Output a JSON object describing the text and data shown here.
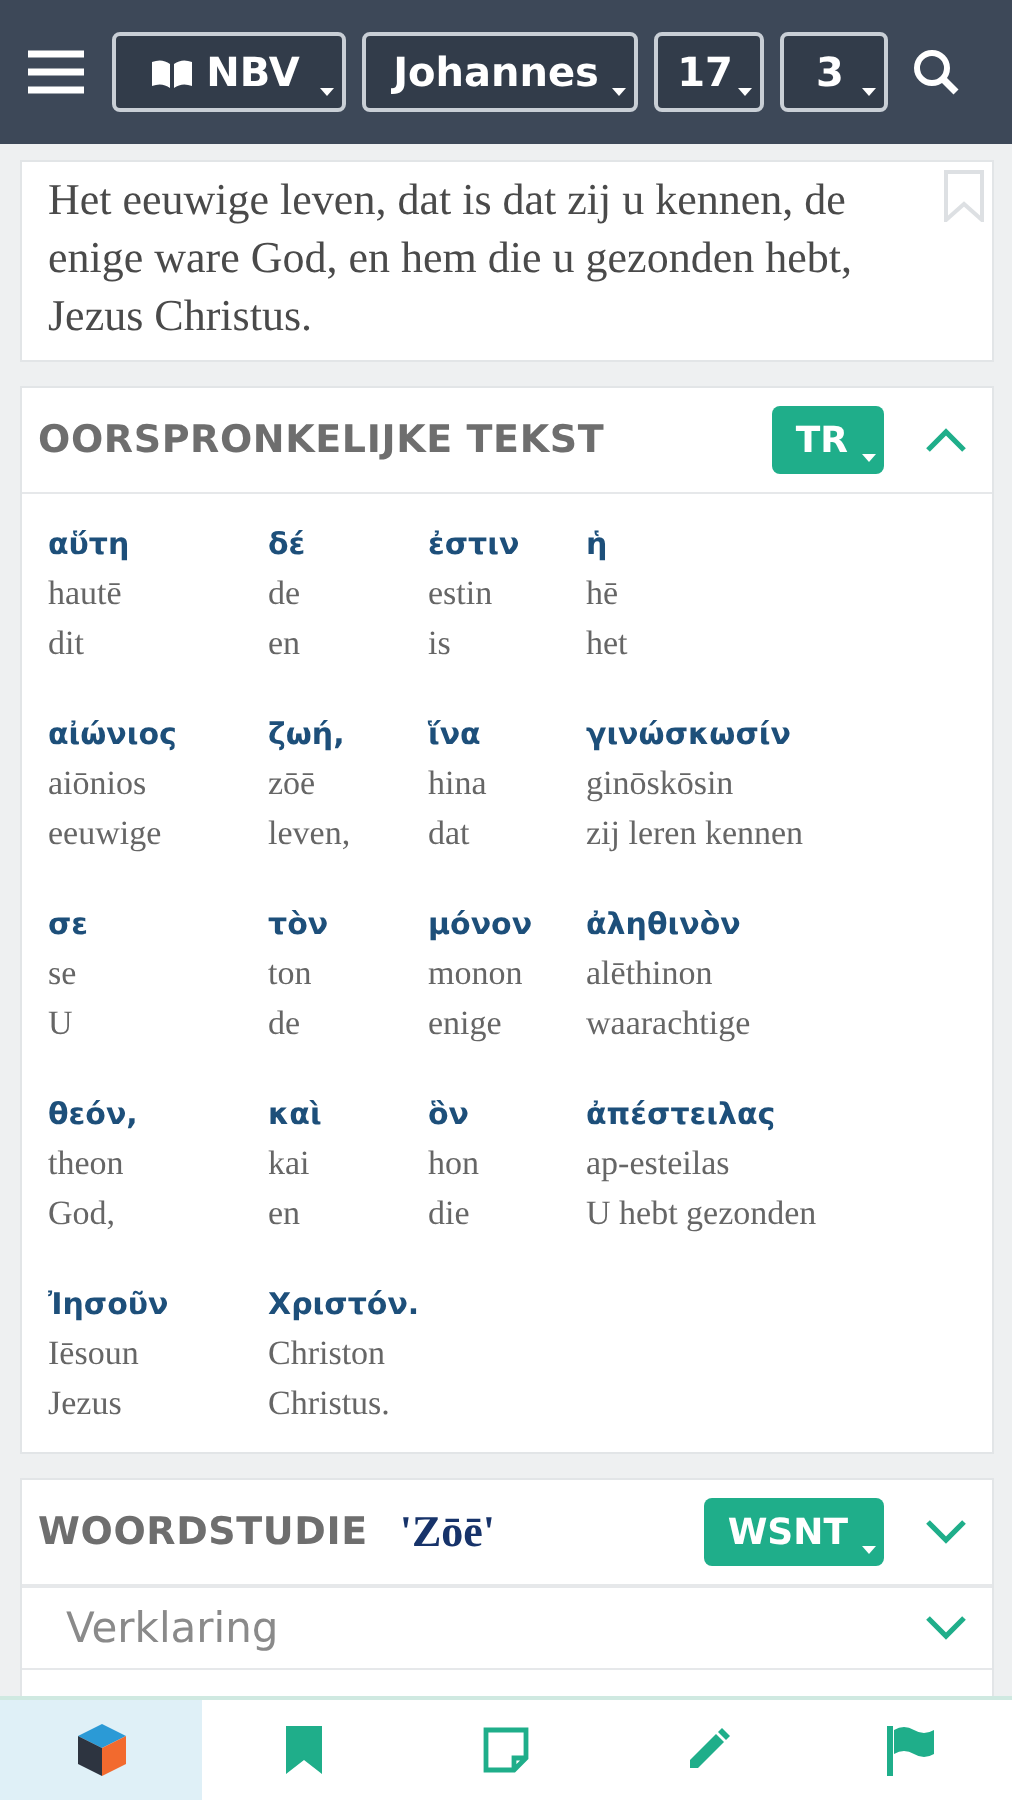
{
  "toolbar": {
    "translation": "NBV",
    "book": "Johannes",
    "chapter": "17",
    "verse": "3"
  },
  "verse": {
    "text": "Het eeuwige leven, dat is dat zij u kennen, de enige ware God, en hem die u gezonden hebt, Jezus Christus.",
    "bookmarked": false
  },
  "original_text": {
    "title": "OORSPRONKELIJKE TEKST",
    "source": "TR",
    "expanded": true,
    "words": [
      {
        "greek": "αὕτη",
        "transliteration": "hautē",
        "translation": "dit"
      },
      {
        "greek": "δέ",
        "transliteration": "de",
        "translation": "en"
      },
      {
        "greek": "ἐστιν",
        "transliteration": "estin",
        "translation": "is"
      },
      {
        "greek": "ἡ",
        "transliteration": "hē",
        "translation": "het"
      },
      {
        "greek": "αἰώνιος",
        "transliteration": "aiōnios",
        "translation": "eeuwige"
      },
      {
        "greek": "ζωή,",
        "transliteration": "zōē",
        "translation": "leven,"
      },
      {
        "greek": "ἵνα",
        "transliteration": "hina",
        "translation": "dat"
      },
      {
        "greek": "γινώσκωσίν",
        "transliteration": "ginōskōsin",
        "translation": "zij leren kennen"
      },
      {
        "greek": "σε",
        "transliteration": "se",
        "translation": "U"
      },
      {
        "greek": "τὸν",
        "transliteration": "ton",
        "translation": "de"
      },
      {
        "greek": "μόνον",
        "transliteration": "monon",
        "translation": "enige"
      },
      {
        "greek": "ἀληθινὸν",
        "transliteration": "alēthinon",
        "translation": "waarachtige"
      },
      {
        "greek": "θεόν,",
        "transliteration": "theon",
        "translation": "God,"
      },
      {
        "greek": "καὶ",
        "transliteration": "kai",
        "translation": "en"
      },
      {
        "greek": "ὃν",
        "transliteration": "hon",
        "translation": "die"
      },
      {
        "greek": "ἀπέστειλας",
        "transliteration": "ap-esteilas",
        "translation": "U hebt gezonden"
      },
      {
        "greek": "Ἰησοῦν",
        "transliteration": "Iēsoun",
        "translation": "Jezus"
      },
      {
        "greek": "Χριστόν.",
        "transliteration": "Christon",
        "translation": "Christus."
      }
    ]
  },
  "word_study": {
    "title": "WOORDSTUDIE",
    "term": "'Zōē'",
    "source": "WSNT",
    "expanded": false,
    "sections": [
      {
        "label": "Verklaring",
        "expanded": false
      }
    ]
  },
  "bottom_nav": [
    {
      "kind": "cube",
      "selected": true
    },
    {
      "kind": "bookmark",
      "selected": false
    },
    {
      "kind": "note",
      "selected": false
    },
    {
      "kind": "pencil",
      "selected": false
    },
    {
      "kind": "flag",
      "selected": false
    }
  ]
}
